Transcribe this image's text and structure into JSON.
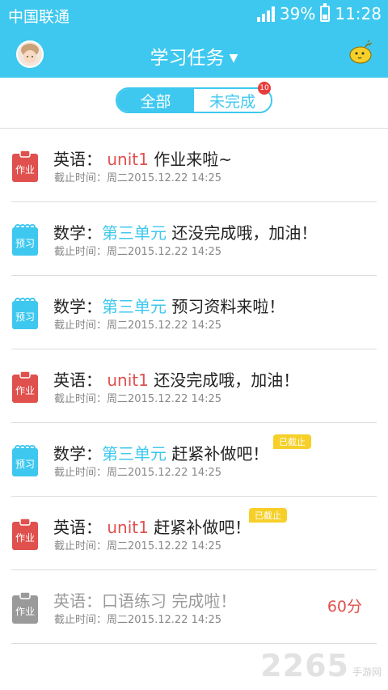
{
  "status": {
    "carrier": "中国联通",
    "battery": "39%",
    "time": "11:28"
  },
  "header": {
    "title": "学习任务"
  },
  "filter": {
    "all_label": "全部",
    "undone_label": "未完成",
    "undone_count": "10"
  },
  "colors": {
    "accent": "#3ec8ef",
    "homework": "#e0504d",
    "preview": "#3ec8ef",
    "done": "#9a9a9a",
    "tag": "#f6cf28"
  },
  "tasks": [
    {
      "icon": "homework-icon",
      "icon_label": "作业",
      "subject": "英语：",
      "topic": "unit1",
      "message": "作业来啦~",
      "deadline": "截止时间：周二2015.12.22 14:25"
    },
    {
      "icon": "preview-icon",
      "icon_label": "预习",
      "subject": "数学：",
      "topic": "第三单元",
      "message": "还没完成哦，加油！",
      "deadline": "截止时间：周二2015.12.22 14:25"
    },
    {
      "icon": "preview-icon",
      "icon_label": "预习",
      "subject": "数学：",
      "topic": "第三单元",
      "message": "预习资料来啦！",
      "deadline": "截止时间：周二2015.12.22 14:25"
    },
    {
      "icon": "homework-icon",
      "icon_label": "作业",
      "subject": "英语：",
      "topic": "unit1",
      "message": "还没完成哦，加油！",
      "deadline": "截止时间：周二2015.12.22 14:25"
    },
    {
      "icon": "preview-icon",
      "icon_label": "预习",
      "subject": "数学：",
      "topic": "第三单元",
      "message": "赶紧补做吧！",
      "deadline": "截止时间：周二2015.12.22 14:25",
      "tag": "已截止"
    },
    {
      "icon": "homework-icon",
      "icon_label": "作业",
      "subject": "英语：",
      "topic": "unit1",
      "message": "赶紧补做吧！",
      "deadline": "截止时间：周二2015.12.22 14:25",
      "tag": "已截止"
    },
    {
      "icon": "homework-done-icon",
      "icon_label": "作业",
      "subject": "英语：",
      "topic": "口语练习",
      "message": "完成啦！",
      "deadline": "截止时间：周二2015.12.22 14:25",
      "score": "60分"
    }
  ],
  "watermark": {
    "number": "2265",
    "text": "手游网"
  }
}
